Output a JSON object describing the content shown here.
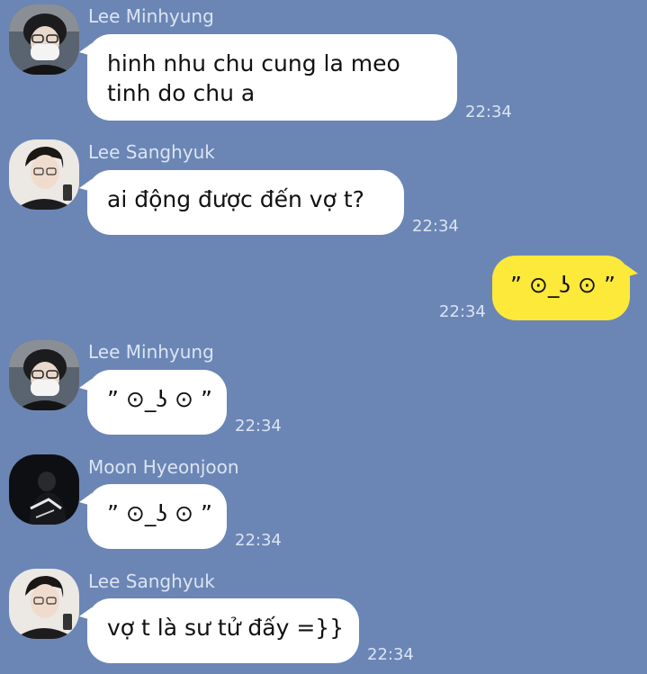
{
  "messages": [
    {
      "sender": "Lee Minhyung",
      "text": [
        "hinh nhu chu cung la meo",
        "tinh do chu a"
      ],
      "time": "22:34"
    },
    {
      "sender": "Lee Sanghyuk",
      "text": "ai động được đến vợ t?",
      "time": "22:34"
    },
    {
      "sender": "",
      "text": "” ⊙_ʖ ⊙ ”",
      "time": "22:34"
    },
    {
      "sender": "Lee Minhyung",
      "text": "” ⊙_ʖ ⊙ ”",
      "time": "22:34"
    },
    {
      "sender": "Moon Hyeonjoon",
      "text": "” ⊙_ʖ ⊙ ”",
      "time": "22:34"
    },
    {
      "sender": "Lee Sanghyuk",
      "text": "vợ t là sư tử đấy =}}",
      "time": "22:34"
    }
  ],
  "colors": {
    "background": "#6b86b5",
    "incoming_bubble": "#ffffff",
    "outgoing_bubble": "#fde93a",
    "meta_text": "#dbe4f2"
  },
  "icons": [
    "avatar-lee-minhyung",
    "avatar-lee-sanghyuk",
    "avatar-moon-hyeonjoon"
  ]
}
